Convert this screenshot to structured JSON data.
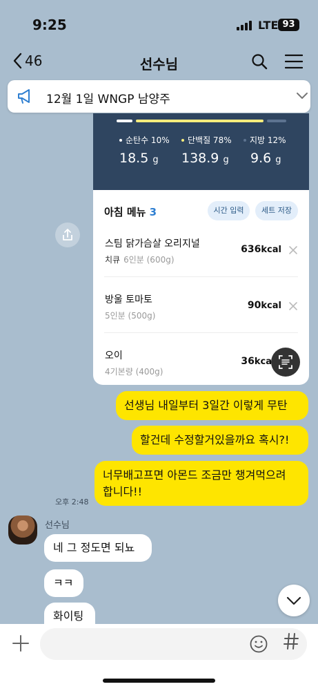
{
  "status_bar": {
    "time": "9:25",
    "network": "LTE",
    "battery": "93"
  },
  "nav": {
    "back_count": "46",
    "title": "선수님"
  },
  "notice": {
    "text": "12월 1일 WNGP 남양주"
  },
  "nutrition": {
    "macros": [
      {
        "label": "순탄수 10%",
        "value": "18.5",
        "unit": "g",
        "color": "#ffffff"
      },
      {
        "label": "단백질 78%",
        "value": "138.9",
        "unit": "g",
        "color": "#f7ec7c"
      },
      {
        "label": "지방 12%",
        "value": "9.6",
        "unit": "g",
        "color": "#5d7390"
      }
    ]
  },
  "meal": {
    "title": "아침 메뉴",
    "count": "3",
    "time_button": "시간 입력",
    "set_button": "세트 저장",
    "items": [
      {
        "name": "스팀 닭가슴살 오리지널",
        "brand": "치큐",
        "portion": "6인분 (600g)",
        "kcal": "636",
        "unit": "kcal"
      },
      {
        "name": "방울 토마토",
        "brand": "",
        "portion": "5인분 (500g)",
        "kcal": "90",
        "unit": "kcal"
      },
      {
        "name": "오이",
        "brand": "",
        "portion": "4기본량 (400g)",
        "kcal": "36",
        "unit": "kca"
      }
    ]
  },
  "messages": {
    "me_1": "선생님 내일부터 3일간 이렇게 무탄",
    "me_2": "할건데 수정할거있을까요 혹시?!",
    "me_3_line1": "너무배고프면 아몬드 조금만 챙겨먹으려",
    "me_3_line2": "합니다!!",
    "me_time": "오후 2:48",
    "sender": "선수님",
    "other_1": "네  그 정도면 되뇨",
    "other_2": "ㅋㅋ",
    "other_3": "화이팅"
  },
  "input": {
    "placeholder": ""
  },
  "icons": {
    "back": "chevron-left-icon",
    "search": "search-icon",
    "menu": "hamburger-menu-icon",
    "notice": "megaphone-icon",
    "expand": "chevron-down-icon",
    "share": "share-icon",
    "scan": "text-scan-icon",
    "remove": "close-icon",
    "scroll": "chevron-down-icon",
    "plus": "plus-icon",
    "emoji": "smiley-icon",
    "hash": "hash-icon"
  }
}
